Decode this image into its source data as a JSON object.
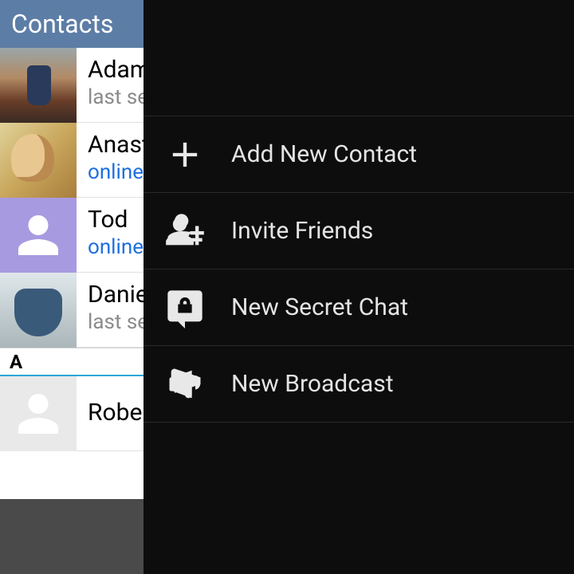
{
  "header": {
    "title": "Contacts"
  },
  "contacts": [
    {
      "name": "Adam",
      "status": "last seen",
      "status_class": ""
    },
    {
      "name": "Anastasia",
      "status": "online",
      "status_class": "online"
    },
    {
      "name": "Tod",
      "status": "online",
      "status_class": "online"
    },
    {
      "name": "Daniel",
      "status": "last seen",
      "status_class": ""
    }
  ],
  "section_letter": "A",
  "section_contact": {
    "name": "Robert"
  },
  "menu": {
    "items": [
      {
        "label": "Add New Contact",
        "icon": "plus-icon"
      },
      {
        "label": "Invite Friends",
        "icon": "person-add-icon"
      },
      {
        "label": "New Secret Chat",
        "icon": "lock-chat-icon"
      },
      {
        "label": "New Broadcast",
        "icon": "megaphone-icon"
      }
    ]
  }
}
